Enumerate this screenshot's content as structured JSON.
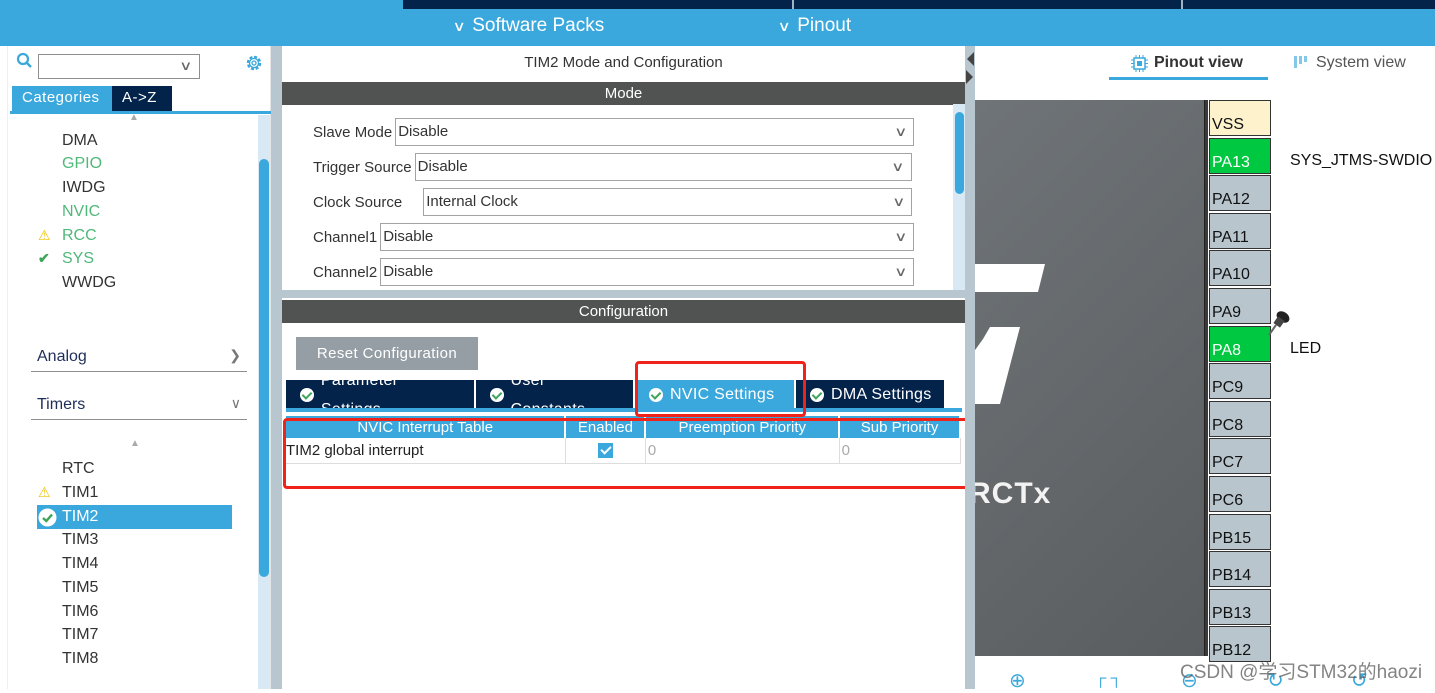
{
  "top_menu": {
    "software_packs": "Software Packs",
    "pinout": "Pinout"
  },
  "sidebar": {
    "search_value": "",
    "tabs": [
      {
        "label": "Categories",
        "active": true
      },
      {
        "label": "A->Z",
        "active": false
      }
    ],
    "system_core_items": [
      {
        "label": "DMA",
        "status": "none",
        "color": "default"
      },
      {
        "label": "GPIO",
        "status": "none",
        "color": "green"
      },
      {
        "label": "IWDG",
        "status": "none",
        "color": "default"
      },
      {
        "label": "NVIC",
        "status": "none",
        "color": "green"
      },
      {
        "label": "RCC",
        "status": "warning",
        "color": "green"
      },
      {
        "label": "SYS",
        "status": "ok",
        "color": "green"
      },
      {
        "label": "WWDG",
        "status": "none",
        "color": "default"
      }
    ],
    "sections": [
      {
        "label": "Analog",
        "expanded": false
      },
      {
        "label": "Timers",
        "expanded": true
      }
    ],
    "timer_items": [
      {
        "label": "RTC",
        "status": "none",
        "selected": false
      },
      {
        "label": "TIM1",
        "status": "warning",
        "selected": false
      },
      {
        "label": "TIM2",
        "status": "ok",
        "selected": true
      },
      {
        "label": "TIM3",
        "status": "none",
        "selected": false
      },
      {
        "label": "TIM4",
        "status": "none",
        "selected": false
      },
      {
        "label": "TIM5",
        "status": "none",
        "selected": false
      },
      {
        "label": "TIM6",
        "status": "none",
        "selected": false
      },
      {
        "label": "TIM7",
        "status": "none",
        "selected": false
      },
      {
        "label": "TIM8",
        "status": "none",
        "selected": false
      }
    ]
  },
  "middle": {
    "title": "TIM2 Mode and Configuration",
    "mode_header": "Mode",
    "mode_fields": [
      {
        "label": "Slave Mode",
        "value": "Disable"
      },
      {
        "label": "Trigger Source",
        "value": "Disable"
      },
      {
        "label": "Clock Source",
        "value": "Internal Clock"
      },
      {
        "label": "Channel1",
        "value": "Disable"
      },
      {
        "label": "Channel2",
        "value": "Disable"
      }
    ],
    "config_header": "Configuration",
    "reset_button": "Reset Configuration",
    "config_tabs": [
      {
        "label": "Parameter Settings",
        "active": false
      },
      {
        "label": "User Constants",
        "active": false
      },
      {
        "label": "NVIC Settings",
        "active": true
      },
      {
        "label": "DMA Settings",
        "active": false
      }
    ],
    "nvic_table": {
      "columns": [
        "NVIC Interrupt Table",
        "Enabled",
        "Preemption Priority",
        "Sub Priority"
      ],
      "rows": [
        {
          "name": "TIM2 global interrupt",
          "enabled": true,
          "preemption": "0",
          "sub": "0"
        }
      ]
    }
  },
  "right": {
    "view_tabs": [
      {
        "label": "Pinout view",
        "active": true
      },
      {
        "label": "System view",
        "active": false
      }
    ],
    "chip_text": "RCTx",
    "pins": [
      {
        "name": "VSS",
        "type": "power",
        "label": ""
      },
      {
        "name": "PA13",
        "type": "assigned",
        "label": "SYS_JTMS-SWDIO"
      },
      {
        "name": "PA12",
        "type": "free",
        "label": ""
      },
      {
        "name": "PA11",
        "type": "free",
        "label": ""
      },
      {
        "name": "PA10",
        "type": "free",
        "label": ""
      },
      {
        "name": "PA9",
        "type": "free",
        "label": ""
      },
      {
        "name": "PA8",
        "type": "assigned",
        "label": "LED"
      },
      {
        "name": "PC9",
        "type": "free",
        "label": ""
      },
      {
        "name": "PC8",
        "type": "free",
        "label": ""
      },
      {
        "name": "PC7",
        "type": "free",
        "label": ""
      },
      {
        "name": "PC6",
        "type": "free",
        "label": ""
      },
      {
        "name": "PB15",
        "type": "free",
        "label": ""
      },
      {
        "name": "PB14",
        "type": "free",
        "label": ""
      },
      {
        "name": "PB13",
        "type": "free",
        "label": ""
      },
      {
        "name": "PB12",
        "type": "free",
        "label": ""
      }
    ],
    "watermark": "CSDN @学习STM32的haozi"
  },
  "colors": {
    "accent": "#3aa8dc",
    "navy": "#03234b",
    "band": "#505352",
    "pin_green": "#00c841",
    "annotation_red": "#f0231b"
  }
}
